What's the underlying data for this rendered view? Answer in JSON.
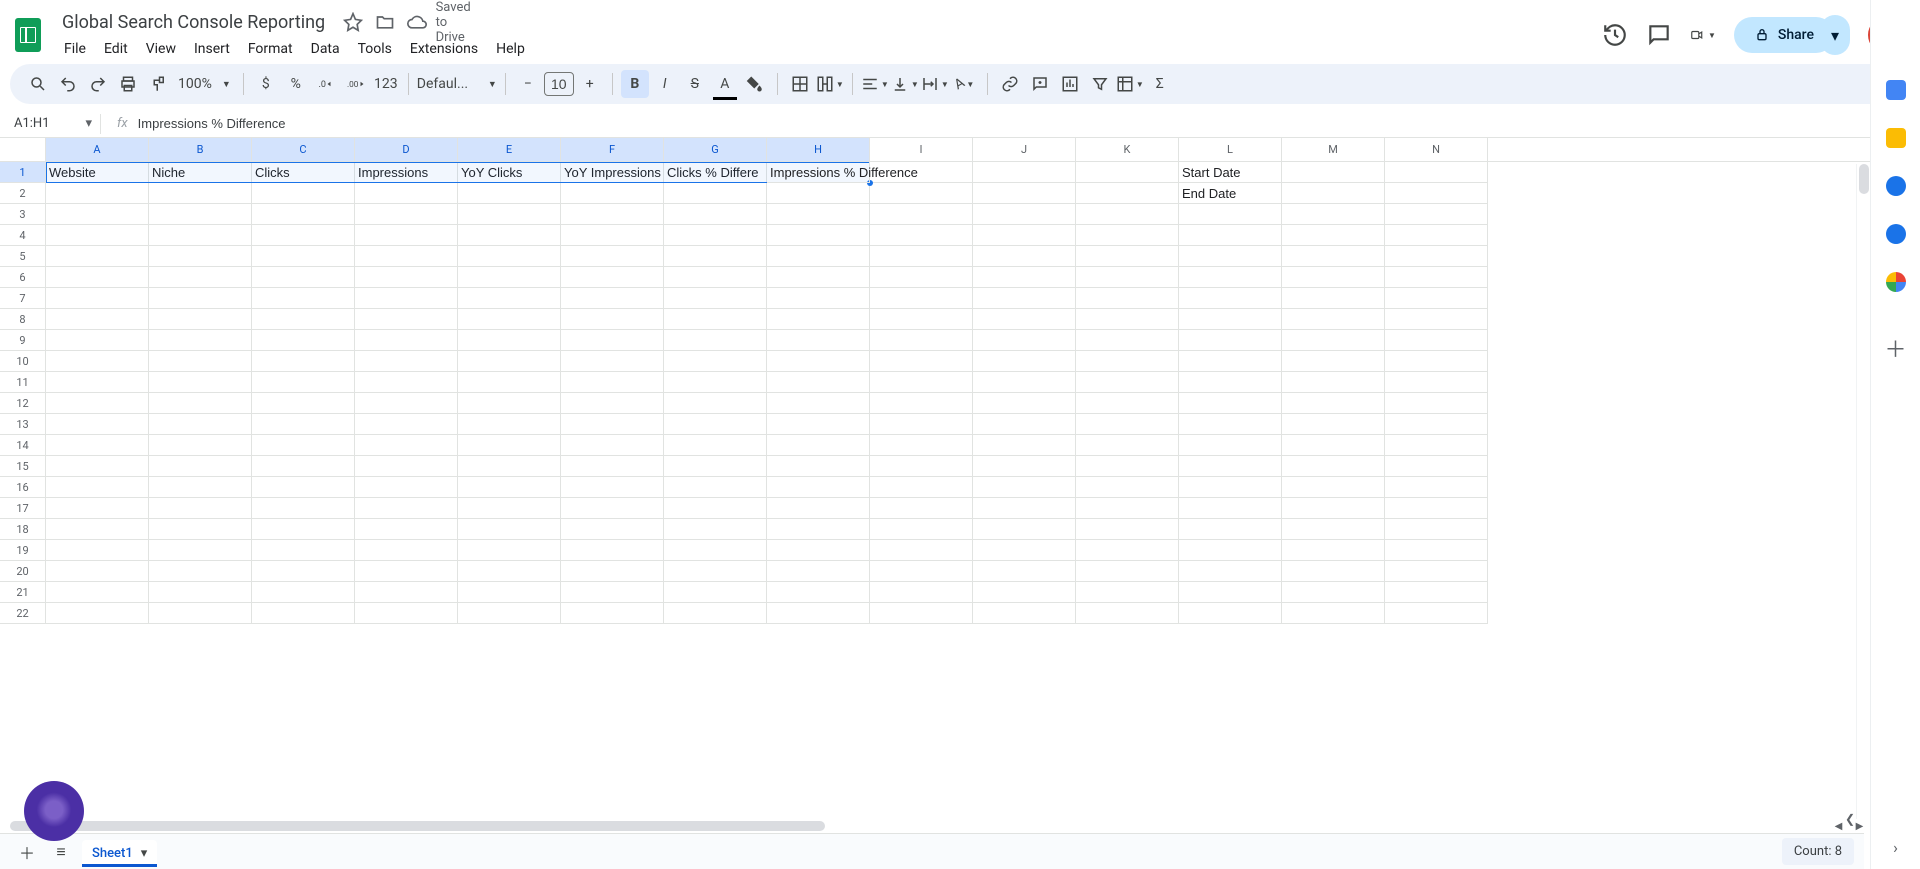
{
  "doc": {
    "title": "Global Search Console Reporting",
    "saved": "Saved to Drive"
  },
  "menu": {
    "file": "File",
    "edit": "Edit",
    "view": "View",
    "insert": "Insert",
    "format": "Format",
    "data": "Data",
    "tools": "Tools",
    "extensions": "Extensions",
    "help": "Help"
  },
  "share": {
    "label": "Share"
  },
  "toolbar": {
    "zoom": "100%",
    "fmt123": "123",
    "font": "Defaul...",
    "fontsize": "10",
    "dollar": "$",
    "percent": "%"
  },
  "namebox": {
    "value": "A1:H1"
  },
  "formula": {
    "fx": "fx",
    "value": "Impressions % Difference"
  },
  "columns": [
    "A",
    "B",
    "C",
    "D",
    "E",
    "F",
    "G",
    "H",
    "I",
    "J",
    "K",
    "L",
    "M",
    "N"
  ],
  "rownums": [
    "1",
    "2",
    "3",
    "4",
    "5",
    "6",
    "7",
    "8",
    "9",
    "10",
    "11",
    "12",
    "13",
    "14",
    "15",
    "16",
    "17",
    "18",
    "19",
    "20",
    "21",
    "22"
  ],
  "cells": {
    "r1": {
      "A": "Website",
      "B": "Niche",
      "C": "Clicks",
      "D": "Impressions",
      "E": "YoY Clicks",
      "F": "YoY Impressions",
      "G": "Clicks % Differe",
      "H": "Impressions % Difference",
      "L": "Start Date"
    },
    "r2": {
      "L": "End Date"
    }
  },
  "sheet": {
    "name": "Sheet1"
  },
  "status": {
    "count": "Count: 8"
  }
}
